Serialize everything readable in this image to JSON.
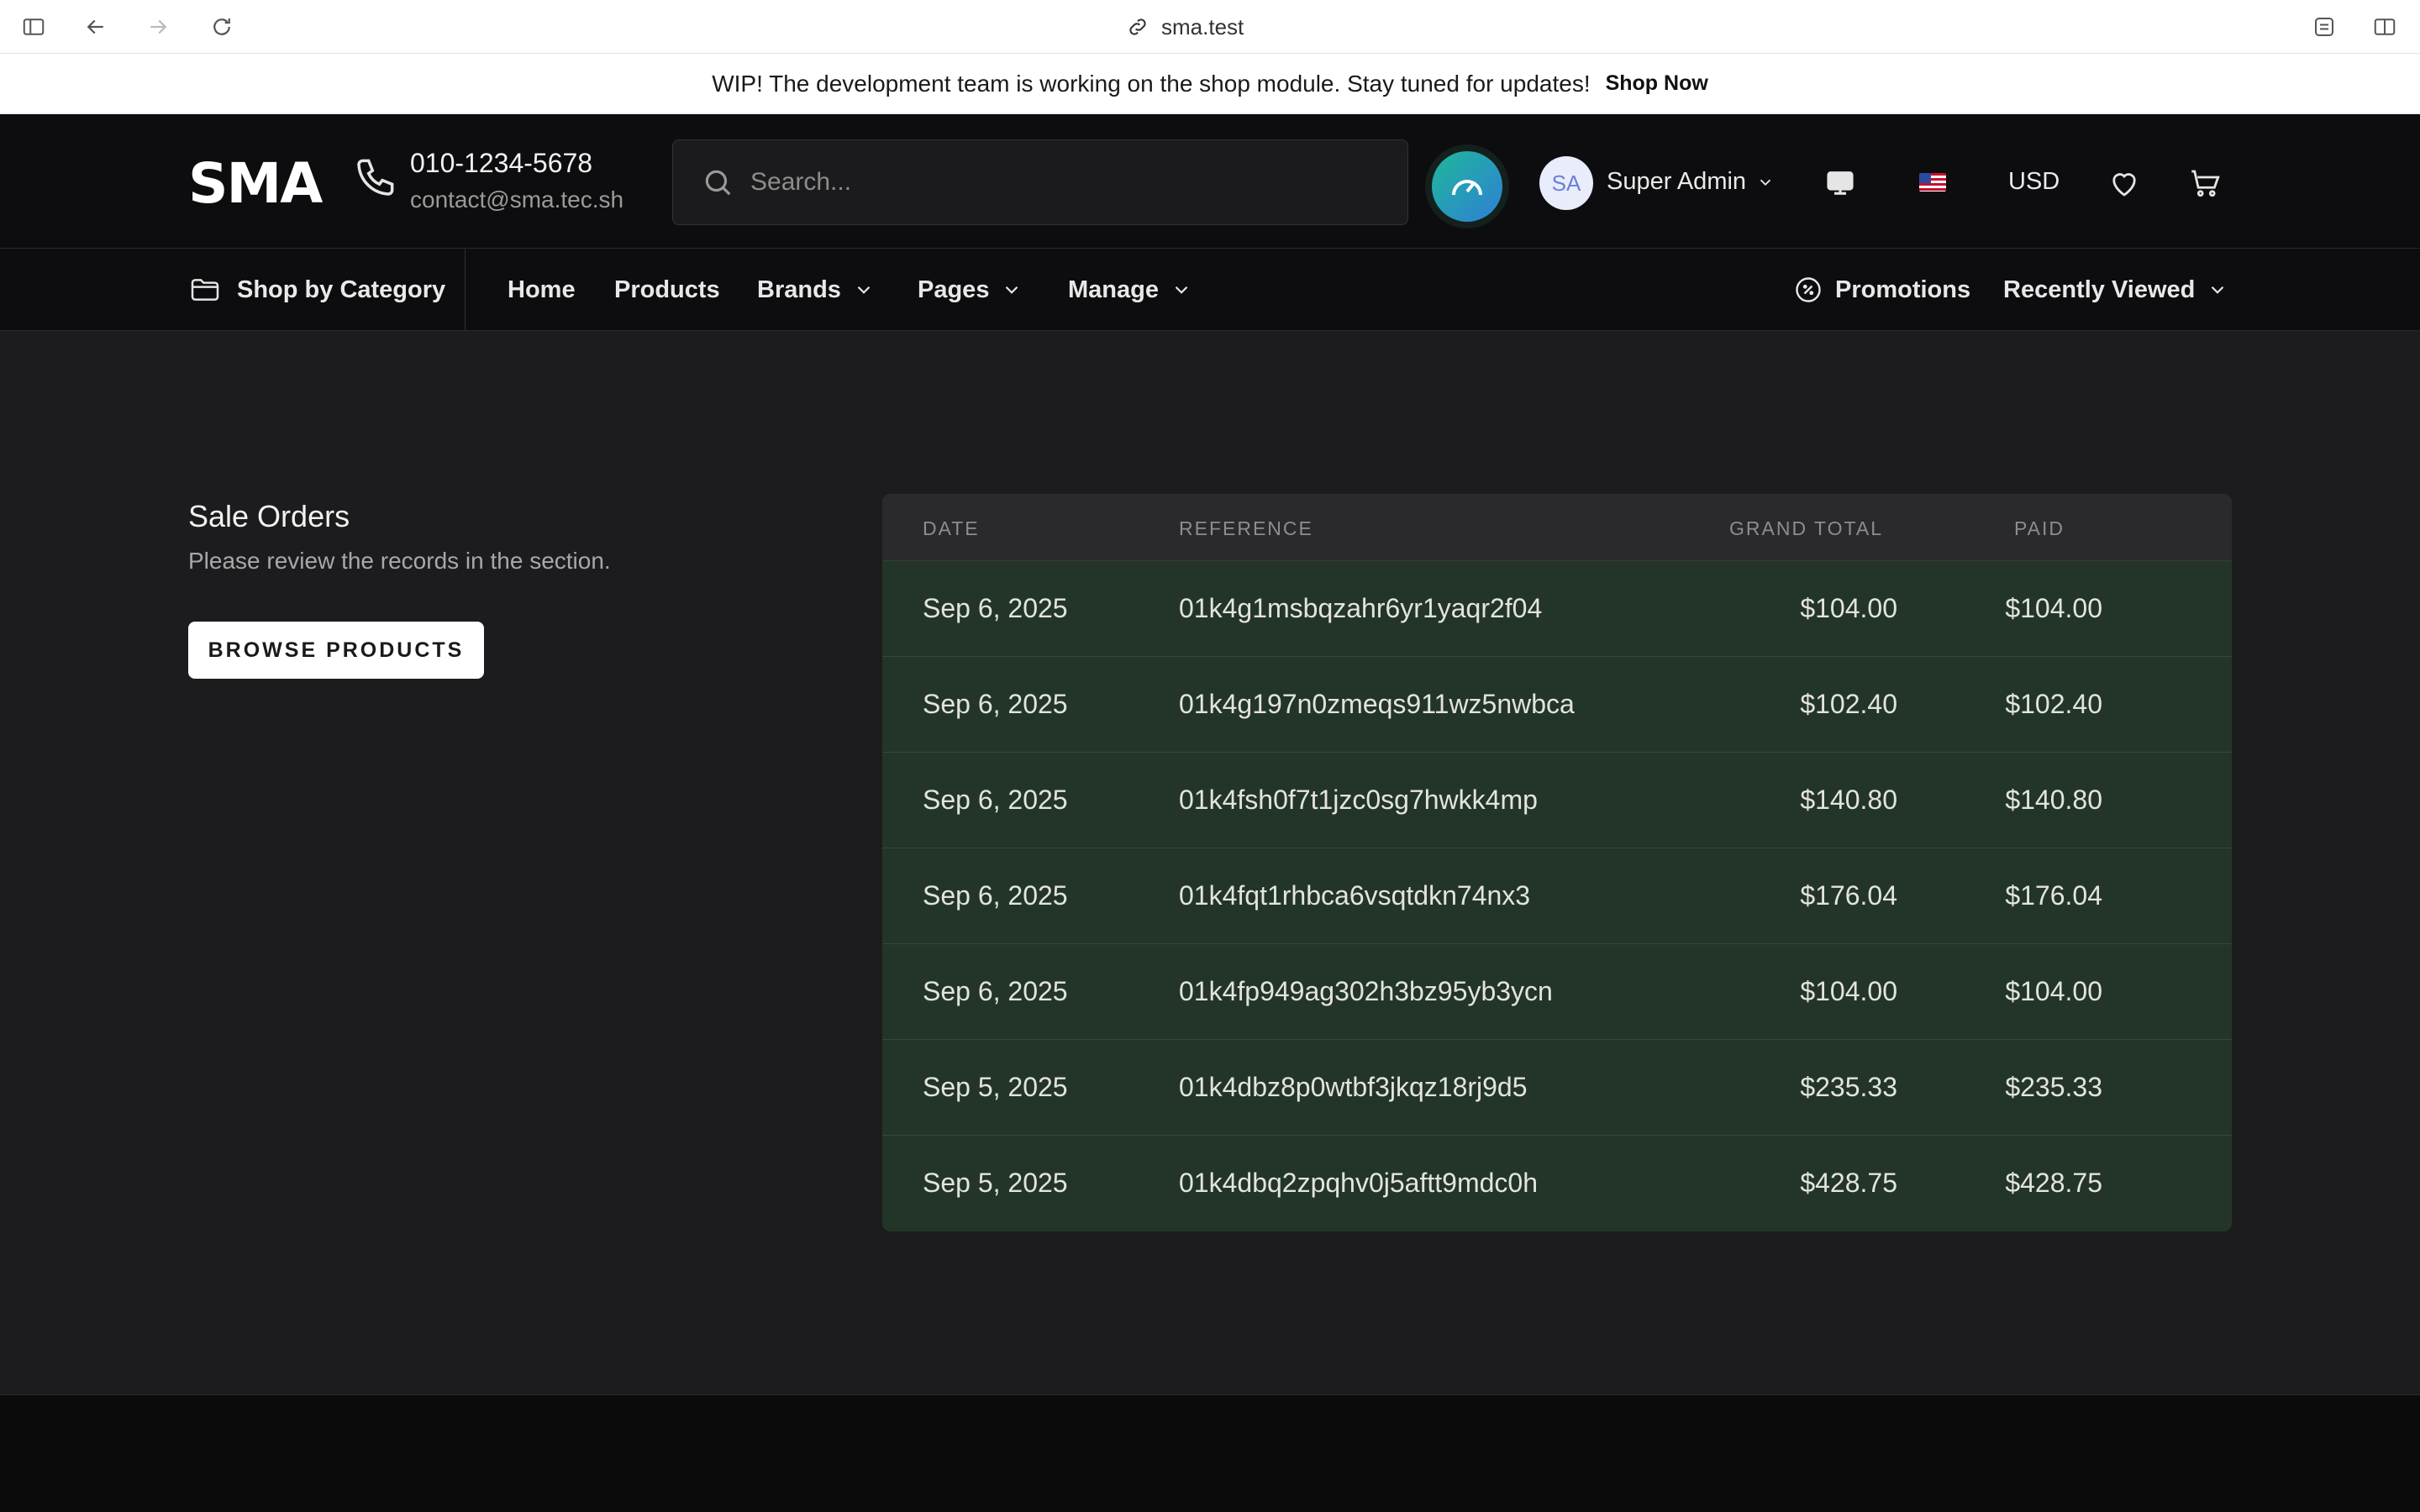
{
  "browser": {
    "url": "sma.test"
  },
  "announcement": {
    "text": "WIP! The development team is working on the shop module. Stay tuned for updates!",
    "link": "Shop Now"
  },
  "header": {
    "logo": "SMA",
    "phone": "010-1234-5678",
    "email": "contact@sma.tec.sh",
    "search_placeholder": "Search...",
    "avatar_initials": "SA",
    "user_name": "Super Admin",
    "currency": "USD"
  },
  "nav": {
    "category": "Shop by Category",
    "items": [
      "Home",
      "Products",
      "Brands",
      "Pages",
      "Manage"
    ],
    "promotions": "Promotions",
    "recently_viewed": "Recently Viewed"
  },
  "section": {
    "title": "Sale Orders",
    "subtitle": "Please review the records in the section.",
    "button": "BROWSE PRODUCTS"
  },
  "table": {
    "headers": [
      "DATE",
      "REFERENCE",
      "GRAND TOTAL",
      "PAID"
    ],
    "rows": [
      {
        "date": "Sep 6, 2025",
        "reference": "01k4g1msbqzahr6yr1yaqr2f04",
        "grand_total": "$104.00",
        "paid": "$104.00"
      },
      {
        "date": "Sep 6, 2025",
        "reference": "01k4g197n0zmeqs911wz5nwbca",
        "grand_total": "$102.40",
        "paid": "$102.40"
      },
      {
        "date": "Sep 6, 2025",
        "reference": "01k4fsh0f7t1jzc0sg7hwkk4mp",
        "grand_total": "$140.80",
        "paid": "$140.80"
      },
      {
        "date": "Sep 6, 2025",
        "reference": "01k4fqt1rhbca6vsqtdkn74nx3",
        "grand_total": "$176.04",
        "paid": "$176.04"
      },
      {
        "date": "Sep 6, 2025",
        "reference": "01k4fp949ag302h3bz95yb3ycn",
        "grand_total": "$104.00",
        "paid": "$104.00"
      },
      {
        "date": "Sep 5, 2025",
        "reference": "01k4dbz8p0wtbf3jkqz18rj9d5",
        "grand_total": "$235.33",
        "paid": "$235.33"
      },
      {
        "date": "Sep 5, 2025",
        "reference": "01k4dbq2zpqhv0j5aftt9mdc0h",
        "grand_total": "$428.75",
        "paid": "$428.75"
      }
    ]
  },
  "icons": {
    "sidebar": "sidebar-icon",
    "back": "back-arrow-icon",
    "forward": "forward-arrow-icon",
    "reload": "reload-icon",
    "link": "link-icon",
    "extensions": "extensions-icon",
    "split": "split-view-icon",
    "phone": "phone-icon",
    "search": "search-icon",
    "speed": "speedometer-icon",
    "monitor": "monitor-icon",
    "flag": "us-flag-icon",
    "heart": "heart-icon",
    "cart": "cart-icon",
    "folder": "folder-icon",
    "promo": "discount-badge-icon",
    "chevron": "chevron-down-icon"
  },
  "colors": {
    "table_row_bg": "#233528",
    "header_bg": "#0d0d0f",
    "accent_gradient_start": "#1fb89a",
    "accent_gradient_end": "#2f7fd6"
  }
}
